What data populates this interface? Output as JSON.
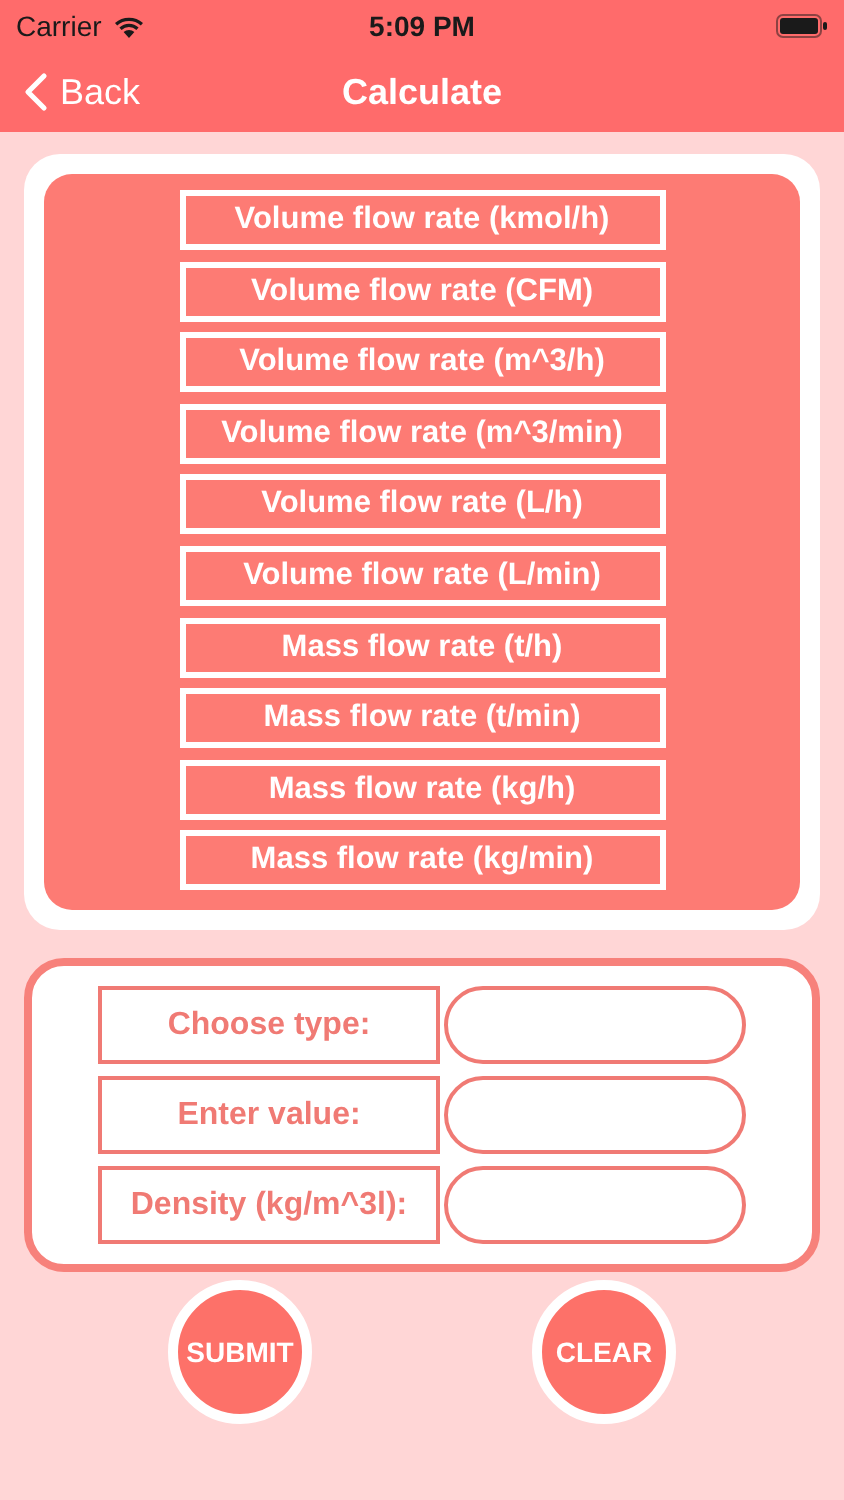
{
  "status_bar": {
    "carrier": "Carrier",
    "time": "5:09 PM"
  },
  "nav": {
    "back": "Back",
    "title": "Calculate"
  },
  "types": [
    "Volume flow rate (kmol/h)",
    "Volume flow rate (CFM)",
    "Volume flow rate (m^3/h)",
    "Volume flow rate (m^3/min)",
    "Volume flow rate (L/h)",
    "Volume flow rate (L/min)",
    "Mass flow rate (t/h)",
    "Mass flow rate (t/min)",
    "Mass flow rate (kg/h)",
    "Mass flow rate (kg/min)"
  ],
  "form": [
    {
      "label": "Choose type:"
    },
    {
      "label": "Enter value:"
    },
    {
      "label": "Density (kg/m^3l):"
    }
  ],
  "buttons": [
    "SUBMIT",
    "CLEAR"
  ]
}
